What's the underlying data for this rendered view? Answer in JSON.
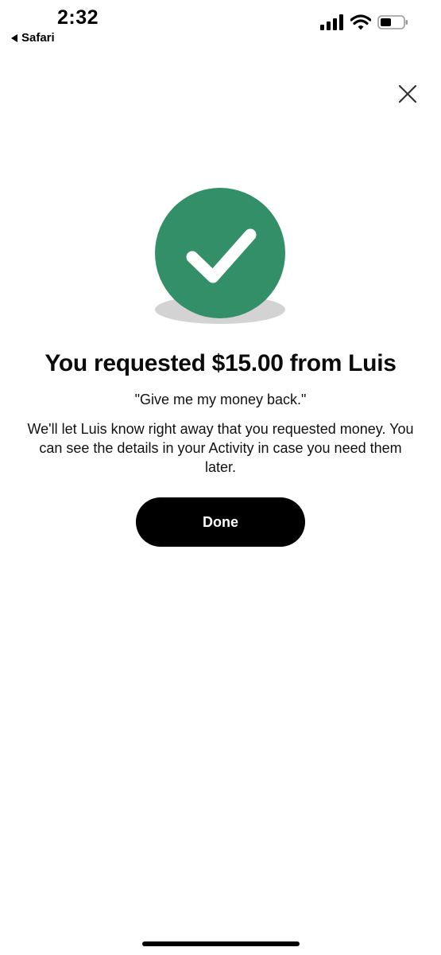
{
  "status_bar": {
    "time": "2:32",
    "back_app": "Safari"
  },
  "icons": {
    "close": "close-icon",
    "success": "checkmark-icon",
    "signal": "cellular-signal-icon",
    "wifi": "wifi-icon",
    "battery": "battery-icon",
    "back": "back-arrow-icon"
  },
  "colors": {
    "success_green": "#328f68",
    "shadow": "#d3d3d3",
    "button_bg": "#000000",
    "button_text": "#ffffff"
  },
  "confirmation": {
    "title": "You requested $15.00 from Luis",
    "note": "\"Give me my money back.\"",
    "description": "We'll let Luis know right away that you requested money. You can see the details in your Activity in case you need them later.",
    "done_label": "Done"
  }
}
